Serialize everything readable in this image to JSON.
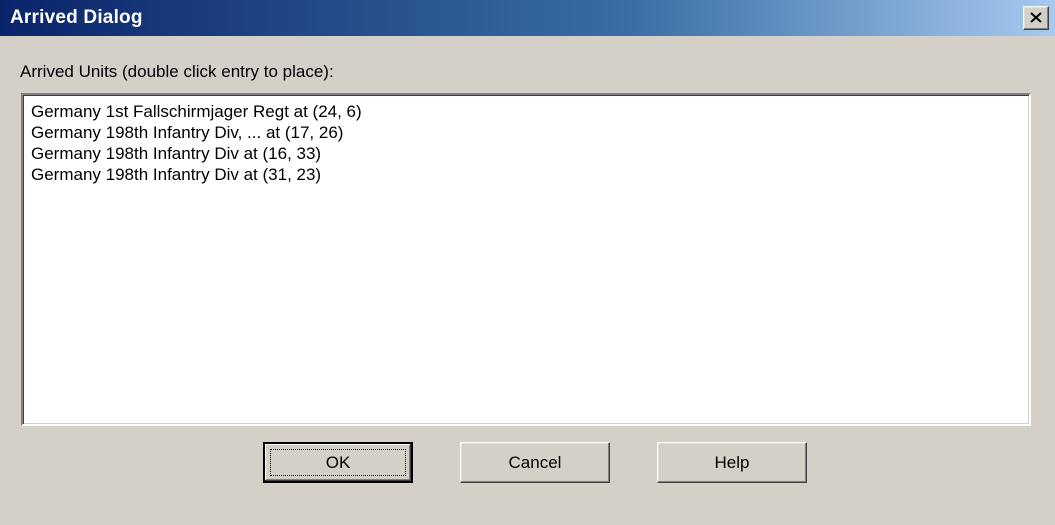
{
  "window": {
    "title": "Arrived Dialog",
    "close_icon": "close-icon"
  },
  "prompt": "Arrived Units (double click entry to place):",
  "units": [
    "Germany 1st Fallschirmjager Regt at (24, 6)",
    "Germany 198th Infantry Div, ... at (17, 26)",
    "Germany 198th Infantry Div at (16, 33)",
    "Germany 198th Infantry Div at (31, 23)"
  ],
  "buttons": {
    "ok": "OK",
    "cancel": "Cancel",
    "help": "Help"
  }
}
